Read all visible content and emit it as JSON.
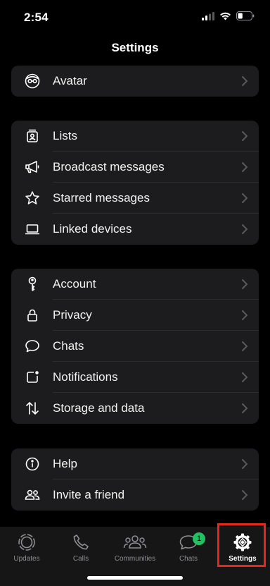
{
  "status_bar": {
    "time": "2:54",
    "battery_level": 0.35
  },
  "nav": {
    "title": "Settings"
  },
  "groups": [
    {
      "items": [
        {
          "label": "Avatar",
          "icon": "avatar-icon"
        }
      ]
    },
    {
      "items": [
        {
          "label": "Lists",
          "icon": "lists-icon"
        },
        {
          "label": "Broadcast messages",
          "icon": "megaphone-icon"
        },
        {
          "label": "Starred messages",
          "icon": "star-icon"
        },
        {
          "label": "Linked devices",
          "icon": "laptop-icon"
        }
      ]
    },
    {
      "items": [
        {
          "label": "Account",
          "icon": "key-icon"
        },
        {
          "label": "Privacy",
          "icon": "lock-icon"
        },
        {
          "label": "Chats",
          "icon": "chat-bubble-icon"
        },
        {
          "label": "Notifications",
          "icon": "notification-icon"
        },
        {
          "label": "Storage and data",
          "icon": "storage-arrows-icon"
        }
      ]
    },
    {
      "items": [
        {
          "label": "Help",
          "icon": "info-icon"
        },
        {
          "label": "Invite a friend",
          "icon": "people-icon"
        }
      ]
    }
  ],
  "tabbar": {
    "tabs": [
      {
        "label": "Updates",
        "icon": "updates-icon"
      },
      {
        "label": "Calls",
        "icon": "phone-icon"
      },
      {
        "label": "Communities",
        "icon": "communities-icon"
      },
      {
        "label": "Chats",
        "icon": "chats-tab-icon",
        "badge": "1"
      },
      {
        "label": "Settings",
        "icon": "settings-gear-icon",
        "active": true
      }
    ]
  },
  "colors": {
    "accent": "#21c063",
    "highlight": "#e8261c",
    "cell": "#1c1c1e"
  }
}
